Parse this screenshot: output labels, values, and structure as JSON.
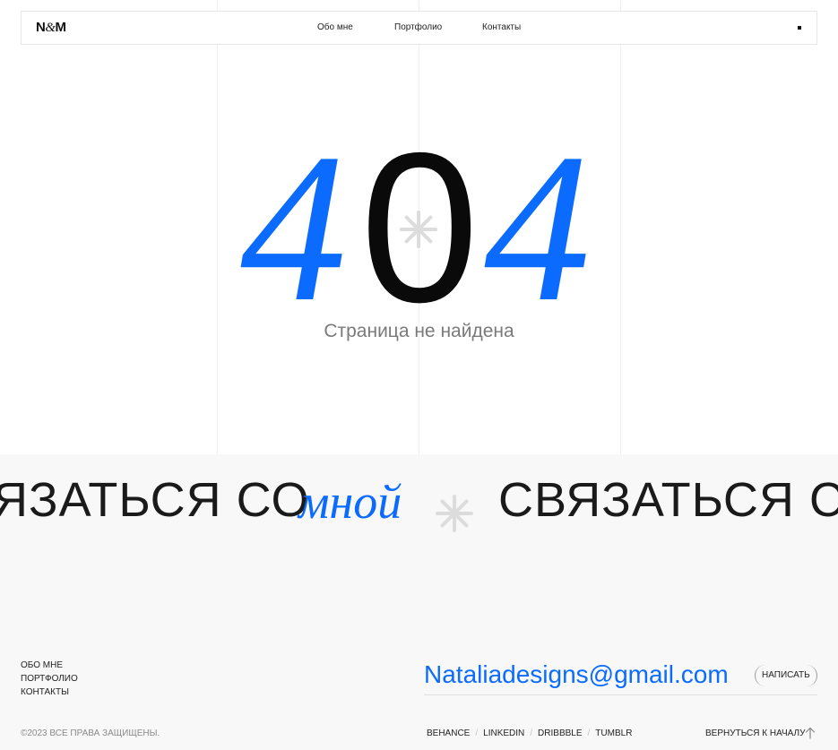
{
  "header": {
    "logo_left": "N",
    "logo_amp": "&",
    "logo_right": "M",
    "nav": [
      {
        "label": "Обо мне"
      },
      {
        "label": "Портфолио"
      },
      {
        "label": "Контакты"
      }
    ],
    "menu_icon": "menu-square-icon"
  },
  "hero": {
    "code_first": "4",
    "code_middle": "0",
    "code_last": "4",
    "message": "Страница не найдена",
    "decor_icon": "asterisk-icon"
  },
  "marquee": {
    "text_1": "ЯЗАТЬСЯ СО",
    "accent_1": "мной",
    "text_2": "СВЯЗАТЬСЯ СО",
    "separator_icon": "asterisk-icon"
  },
  "footer": {
    "links": [
      {
        "label": "ОБО МНЕ"
      },
      {
        "label": "ПОРТФОЛИО"
      },
      {
        "label": "КОНТАКТЫ"
      }
    ],
    "email": "Nataliadesigns@gmail.com",
    "write_label": "НАПИСАТЬ",
    "copyright": "©2023 ВСЕ ПРАВА ЗАЩИЩЕНЫ.",
    "socials": [
      {
        "label": "BEHANCE"
      },
      {
        "label": "LINKEDIN"
      },
      {
        "label": "DRIBBBLE"
      },
      {
        "label": "TUMBLR"
      }
    ],
    "back_to_top": "ВЕРНУТЬСЯ К НАЧАЛУ",
    "back_to_top_icon": "arrow-up-icon"
  },
  "colors": {
    "accent": "#0c6bff",
    "text": "#1a1a1a",
    "muted": "#7a7a7a",
    "footer_bg": "#f8f8f8",
    "decor": "#dcdcdc"
  }
}
